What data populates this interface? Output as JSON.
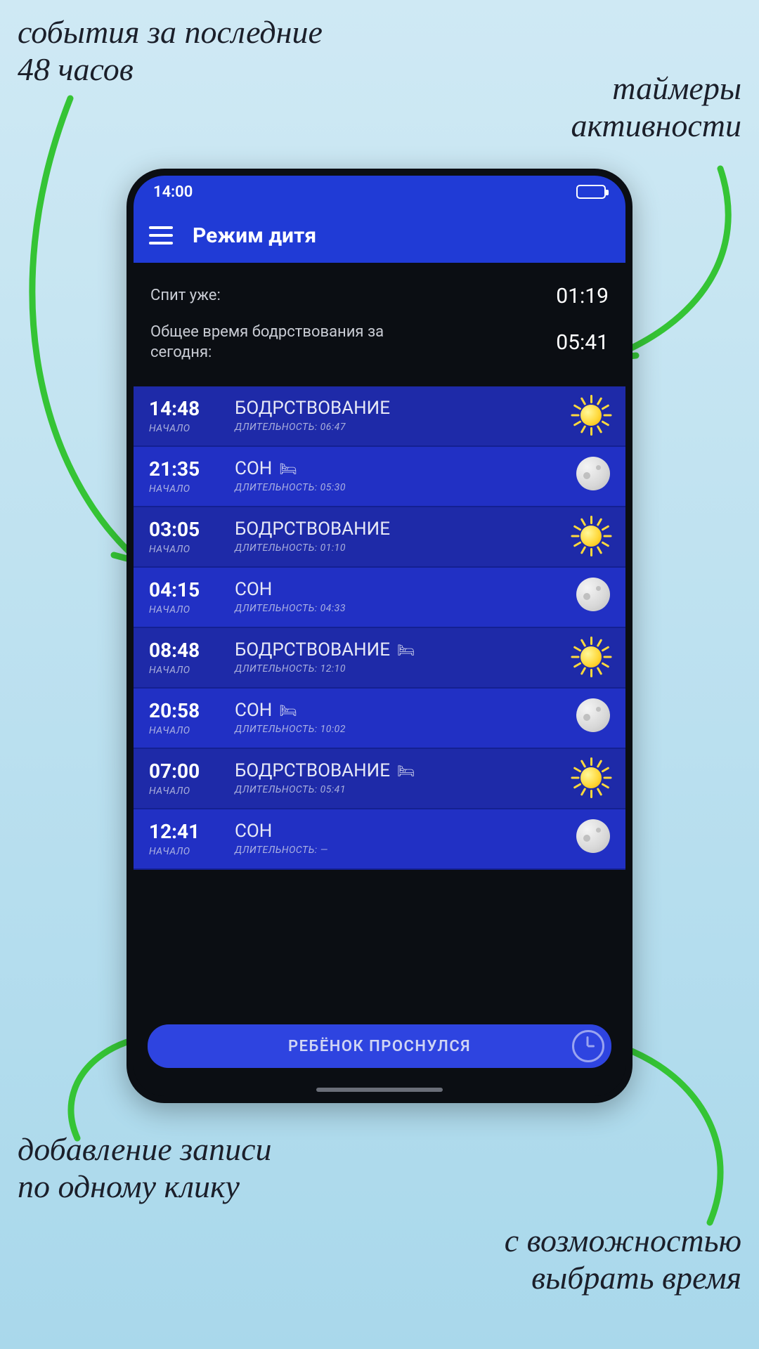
{
  "annotations": {
    "topleft": "события за последние\n48 часов",
    "topright": "таймеры\nактивности",
    "botleft": "добавление записи\nпо одному клику",
    "botright": "с возможностью\nвыбрать время"
  },
  "statusbar": {
    "time": "14:00"
  },
  "appbar": {
    "title": "Режим дитя"
  },
  "timers": {
    "row1_label": "Спит уже:",
    "row1_value": "01:19",
    "row2_label": "Общее время бодрствования за сегодня:",
    "row2_value": "05:41"
  },
  "labels": {
    "start": "НАЧАЛО",
    "duration_prefix": "ДЛИТЕЛЬНОСТЬ:"
  },
  "events": [
    {
      "time": "14:48",
      "title": "БОДРСТВОВАНИЕ",
      "bed": false,
      "duration": "06:47",
      "kind": "sun",
      "shade": "a"
    },
    {
      "time": "21:35",
      "title": "СОН",
      "bed": true,
      "duration": "05:30",
      "kind": "moon",
      "shade": "b"
    },
    {
      "time": "03:05",
      "title": "БОДРСТВОВАНИЕ",
      "bed": false,
      "duration": "01:10",
      "kind": "sun",
      "shade": "a"
    },
    {
      "time": "04:15",
      "title": "СОН",
      "bed": false,
      "duration": "04:33",
      "kind": "moon",
      "shade": "b"
    },
    {
      "time": "08:48",
      "title": "БОДРСТВОВАНИЕ",
      "bed": true,
      "duration": "12:10",
      "kind": "sun",
      "shade": "a"
    },
    {
      "time": "20:58",
      "title": "СОН",
      "bed": true,
      "duration": "10:02",
      "kind": "moon",
      "shade": "b"
    },
    {
      "time": "07:00",
      "title": "БОДРСТВОВАНИЕ",
      "bed": true,
      "duration": "05:41",
      "kind": "sun",
      "shade": "a"
    },
    {
      "time": "12:41",
      "title": "СОН",
      "bed": false,
      "duration": "—",
      "kind": "moon",
      "shade": "b"
    }
  ],
  "action": {
    "label": "РЕБЁНОК ПРОСНУЛСЯ"
  }
}
